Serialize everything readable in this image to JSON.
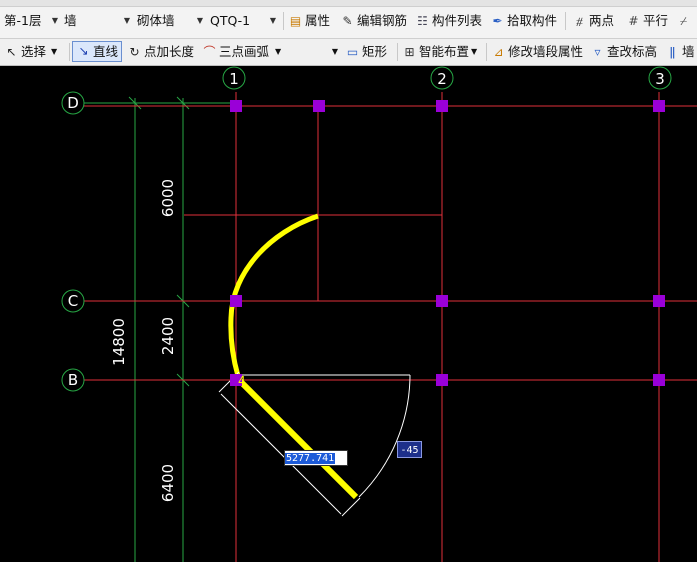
{
  "toolbar1": {
    "floor": "第-1层",
    "category": "墙",
    "type": "砌体墙",
    "component": "QTQ-1",
    "properties": "属性",
    "edit_rebar": "编辑钢筋",
    "component_list": "构件列表",
    "pick_component": "拾取构件",
    "two_points": "两点",
    "parallel": "平行"
  },
  "toolbar2": {
    "select": "选择",
    "line": "直线",
    "point_add_length": "点加长度",
    "three_point_arc": "三点画弧",
    "rectangle": "矩形",
    "smart_layout": "智能布置",
    "modify_wall_segment": "修改墙段属性",
    "check_elevation": "查改标高",
    "wall_cut": "墙"
  },
  "grid": {
    "vertical_axes": [
      "1",
      "2",
      "3"
    ],
    "horizontal_axes": [
      "D",
      "C",
      "B"
    ],
    "dims_segment": [
      "6000",
      "2400",
      "6400"
    ],
    "dim_total": "14800",
    "colors": {
      "axis": "#e0303a",
      "dim": "#27a745",
      "wall": "#ffff00",
      "column": "#9a00d8",
      "label": "#ffffff"
    }
  },
  "drawing": {
    "length_input": "5277.741",
    "angle_label": "-45",
    "snap_marker": "4"
  }
}
